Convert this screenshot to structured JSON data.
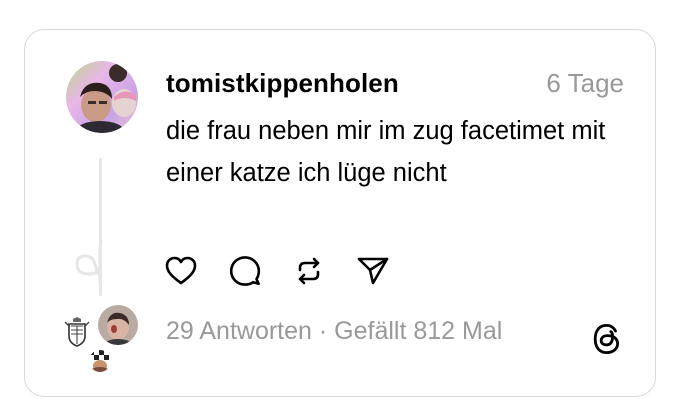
{
  "post": {
    "username": "tomistkippenholen",
    "timestamp": "6 Tage",
    "text": "die frau neben mir im zug facetimet mit einer katze ich lüge nicht"
  },
  "actions": [
    {
      "name": "like",
      "icon": "heart-icon"
    },
    {
      "name": "reply",
      "icon": "comment-bubble-icon"
    },
    {
      "name": "repost",
      "icon": "repost-icon"
    },
    {
      "name": "share",
      "icon": "send-icon"
    }
  ],
  "stats": {
    "replies": "29 Antworten",
    "separator": " · ",
    "likes": "Gefällt 812 Mal"
  },
  "colors": {
    "text": "#000000",
    "muted": "#999999",
    "border": "#d9d9d9",
    "thread_line": "#e6e6e6"
  }
}
